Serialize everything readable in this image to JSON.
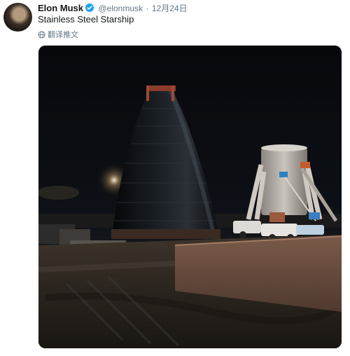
{
  "tweet": {
    "author_name": "Elon Musk",
    "handle": "@elonmusk",
    "separator": "·",
    "date": "12月24日",
    "text": "Stainless Steel Starship",
    "translate_label": "翻译推文"
  },
  "colors": {
    "verified": "#1da1f2",
    "secondary_text": "#657786"
  },
  "icons": {
    "verified": "verified-badge-icon",
    "translate": "globe-icon"
  }
}
